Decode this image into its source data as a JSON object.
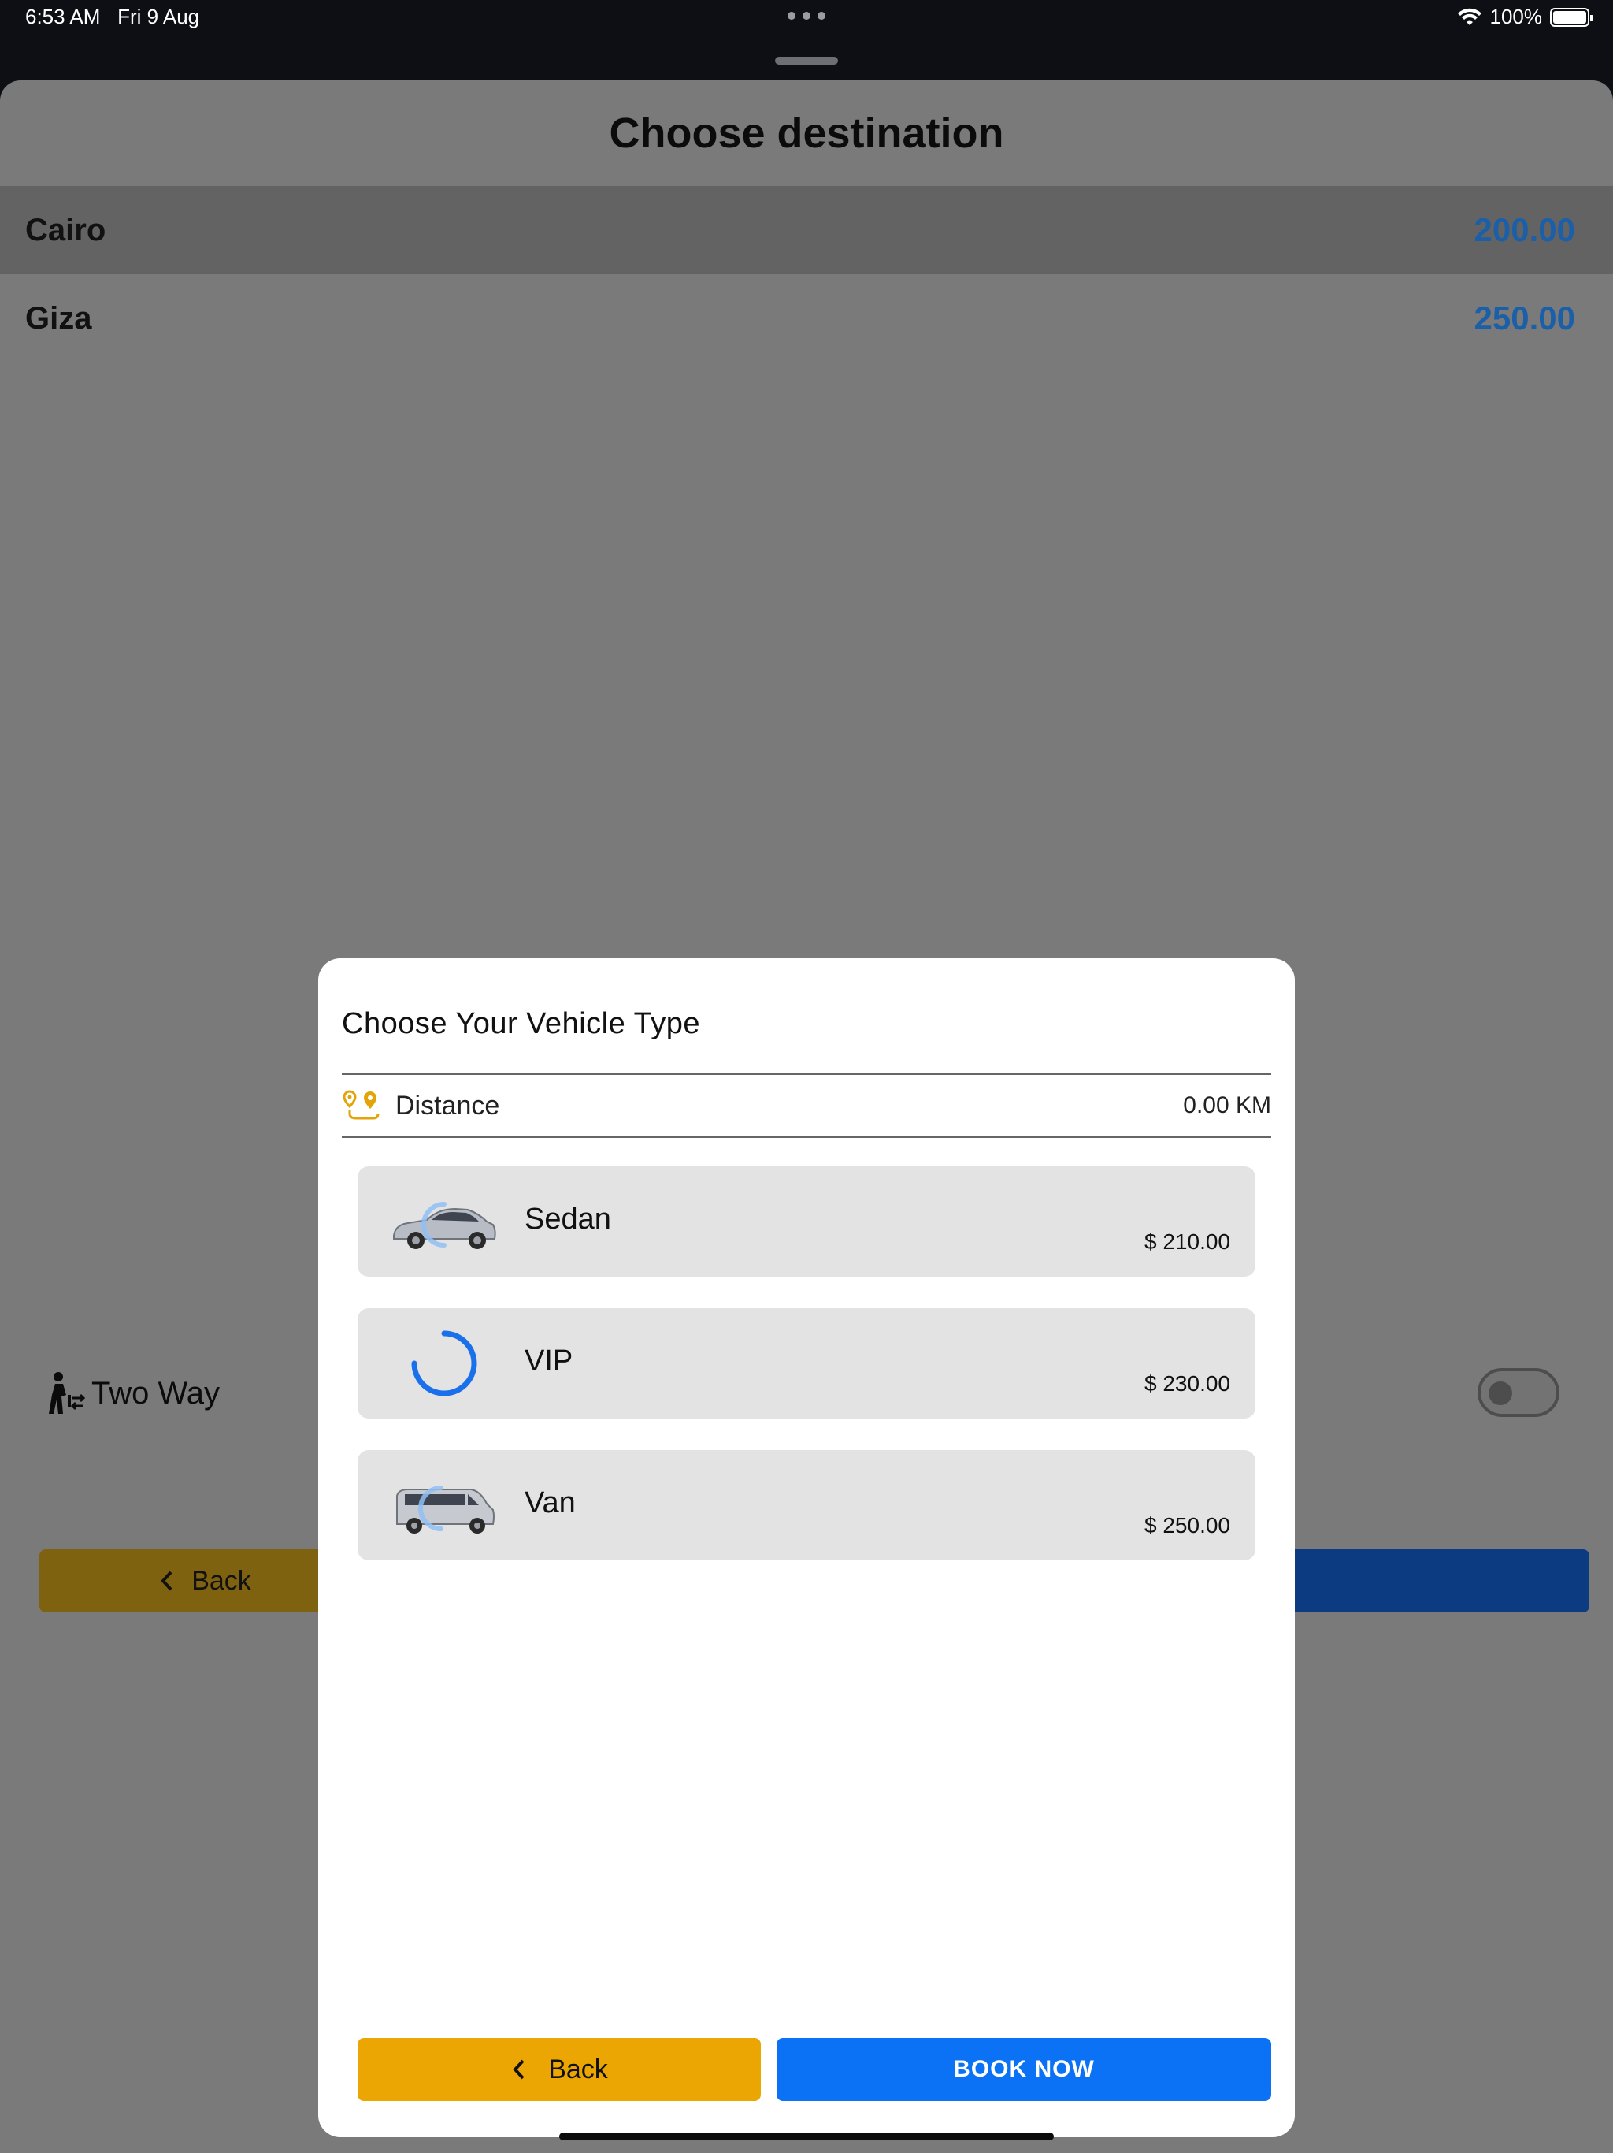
{
  "status_bar": {
    "time": "6:53 AM",
    "date": "Fri 9 Aug",
    "battery": "100%"
  },
  "screen": {
    "title": "Choose destination",
    "destinations": [
      {
        "name": "Cairo",
        "price": "200.00",
        "selected": true
      },
      {
        "name": "Giza",
        "price": "250.00",
        "selected": false
      }
    ],
    "two_way_label": "Two Way",
    "two_way_enabled": false,
    "back_label": "Back"
  },
  "modal": {
    "title": "Choose Your Vehicle Type",
    "distance_label": "Distance",
    "distance_value": "0.00 KM",
    "vehicles": [
      {
        "name": "Sedan",
        "price": "$ 210.00",
        "icon": "sedan-car-image"
      },
      {
        "name": "VIP",
        "price": "$ 230.00",
        "icon": "loading-spinner-icon"
      },
      {
        "name": "Van",
        "price": "$ 250.00",
        "icon": "van-image"
      }
    ],
    "back_label": "Back",
    "book_label": "BOOK NOW"
  },
  "colors": {
    "accent_blue": "#0b72f5",
    "accent_yellow": "#eba604",
    "price_blue": "#1a5fa8"
  }
}
